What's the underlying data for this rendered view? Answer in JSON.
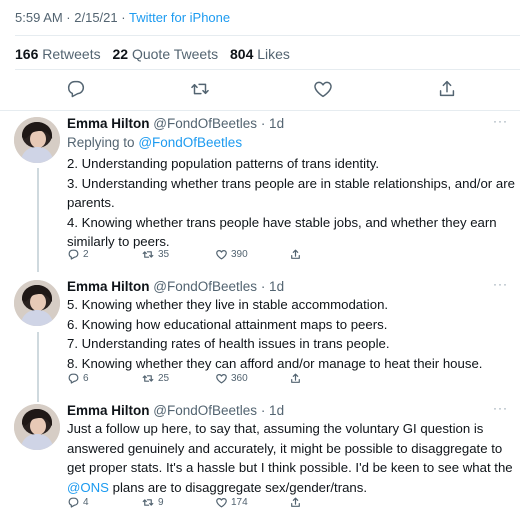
{
  "header": {
    "timestamp": "5:59 AM · 2/15/21 ·",
    "source": "Twitter for iPhone"
  },
  "stats": {
    "retweets_count": "166",
    "retweets_label": "Retweets",
    "quotes_count": "22",
    "quotes_label": "Quote Tweets",
    "likes_count": "804",
    "likes_label": "Likes"
  },
  "replies": [
    {
      "name": "Emma Hilton",
      "handle": "@FondOfBeetles",
      "time": "· 1d",
      "replying_label": "Replying to",
      "replying_to": "@FondOfBeetles",
      "lines": [
        "2. Understanding population patterns of trans identity.",
        "3. Understanding whether trans people are in stable relationships, and/or are",
        "parents.",
        "4. Knowing whether trans people have stable jobs, and whether they earn",
        "similarly to peers."
      ],
      "reply_count": "2",
      "retweet_count": "35",
      "like_count": "390"
    },
    {
      "name": "Emma Hilton",
      "handle": "@FondOfBeetles",
      "time": "· 1d",
      "lines": [
        "5. Knowing whether they live in stable accommodation.",
        "6. Knowing how educational attainment maps to peers.",
        "7. Understanding rates of health issues in trans people.",
        "8. Knowing whether they can afford and/or manage to heat their house."
      ],
      "reply_count": "6",
      "retweet_count": "25",
      "like_count": "360"
    },
    {
      "name": "Emma Hilton",
      "handle": "@FondOfBeetles",
      "time": "· 1d",
      "lines": [
        "Just a follow up here, to say that, assuming the voluntary GI question is",
        "answered genuinely and accurately, it might be possible to disaggregate to",
        "get proper stats. It's a hassle but I think possible. I'd be keen to see what the"
      ],
      "mention": "@ONS",
      "last_line_rest": " plans are to disaggregate sex/gender/trans.",
      "reply_count": "4",
      "retweet_count": "9",
      "like_count": "174"
    }
  ],
  "icons": {
    "reply": "reply-icon",
    "retweet": "retweet-icon",
    "like": "like-icon",
    "share": "share-icon",
    "more": "more-icon"
  },
  "colors": {
    "link": "#1d9bf0",
    "secondary": "#536471",
    "divider": "#e6ecf0"
  }
}
